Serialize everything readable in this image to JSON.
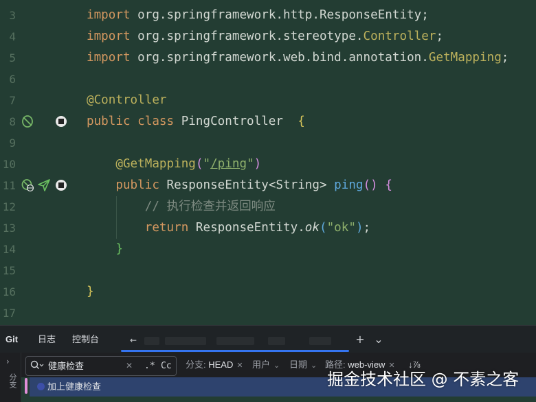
{
  "editor": {
    "line_numbers": [
      "3",
      "4",
      "5",
      "6",
      "7",
      "8",
      "9",
      "10",
      "11",
      "12",
      "13",
      "14",
      "15",
      "16",
      "17"
    ],
    "code": {
      "l3": {
        "kw": "import",
        "rest": " org.springframework.http.ResponseEntity;"
      },
      "l4": {
        "kw": "import",
        "rest": " org.springframework.stereotype.",
        "ann": "Controller",
        "end": ";"
      },
      "l5": {
        "kw": "import",
        "rest": " org.springframework.web.bind.annotation.",
        "ann": "GetMapping",
        "end": ";"
      },
      "l7": {
        "ann": "@Controller"
      },
      "l8": {
        "kw": "public class",
        "rest": " PingController  ",
        "brace": "{"
      },
      "l10": {
        "ann": "@GetMapping",
        "open": "(",
        "str_q1": "\"",
        "str_path": "/ping",
        "str_q2": "\"",
        "close": ")"
      },
      "l11": {
        "kw": "public",
        "type": " ResponseEntity<String> ",
        "fn": "ping",
        "paren": "()",
        "sp": " ",
        "brace": "{"
      },
      "l12": {
        "cmt": "// 执行检查并返回响应"
      },
      "l13": {
        "kw": "return",
        "rest": " ResponseEntity.",
        "fn": "ok",
        "open": "(",
        "str": "\"ok\"",
        "close": ")",
        "end": ";"
      },
      "l14": {
        "brace": "}"
      },
      "l16": {
        "brace": "}"
      }
    }
  },
  "tool_window": {
    "tabs": [
      "Git",
      "日志",
      "控制台"
    ],
    "active_tab": "Git",
    "add_label": "+",
    "more_label": "⌄"
  },
  "git_panel": {
    "side_label": "分支",
    "search": {
      "value": "健康检查",
      "regex_label": ".*",
      "case_label": "Cc"
    },
    "filters": {
      "branch": {
        "label": "分支:",
        "value": "HEAD"
      },
      "user": {
        "label": "用户"
      },
      "date": {
        "label": "日期"
      },
      "path": {
        "label": "路径:",
        "value": "web-view"
      }
    },
    "sort_label": "↓⅞",
    "commit": {
      "message": "加上健康检查"
    }
  },
  "watermark": "掘金技术社区 @ 不素之客",
  "colors": {
    "background": "#233d33",
    "keyword": "#d49860",
    "annotation": "#bcb15c",
    "string": "#8fb06c",
    "function": "#5ea8dc",
    "selection": "#2e436e",
    "accent": "#3574f0"
  }
}
